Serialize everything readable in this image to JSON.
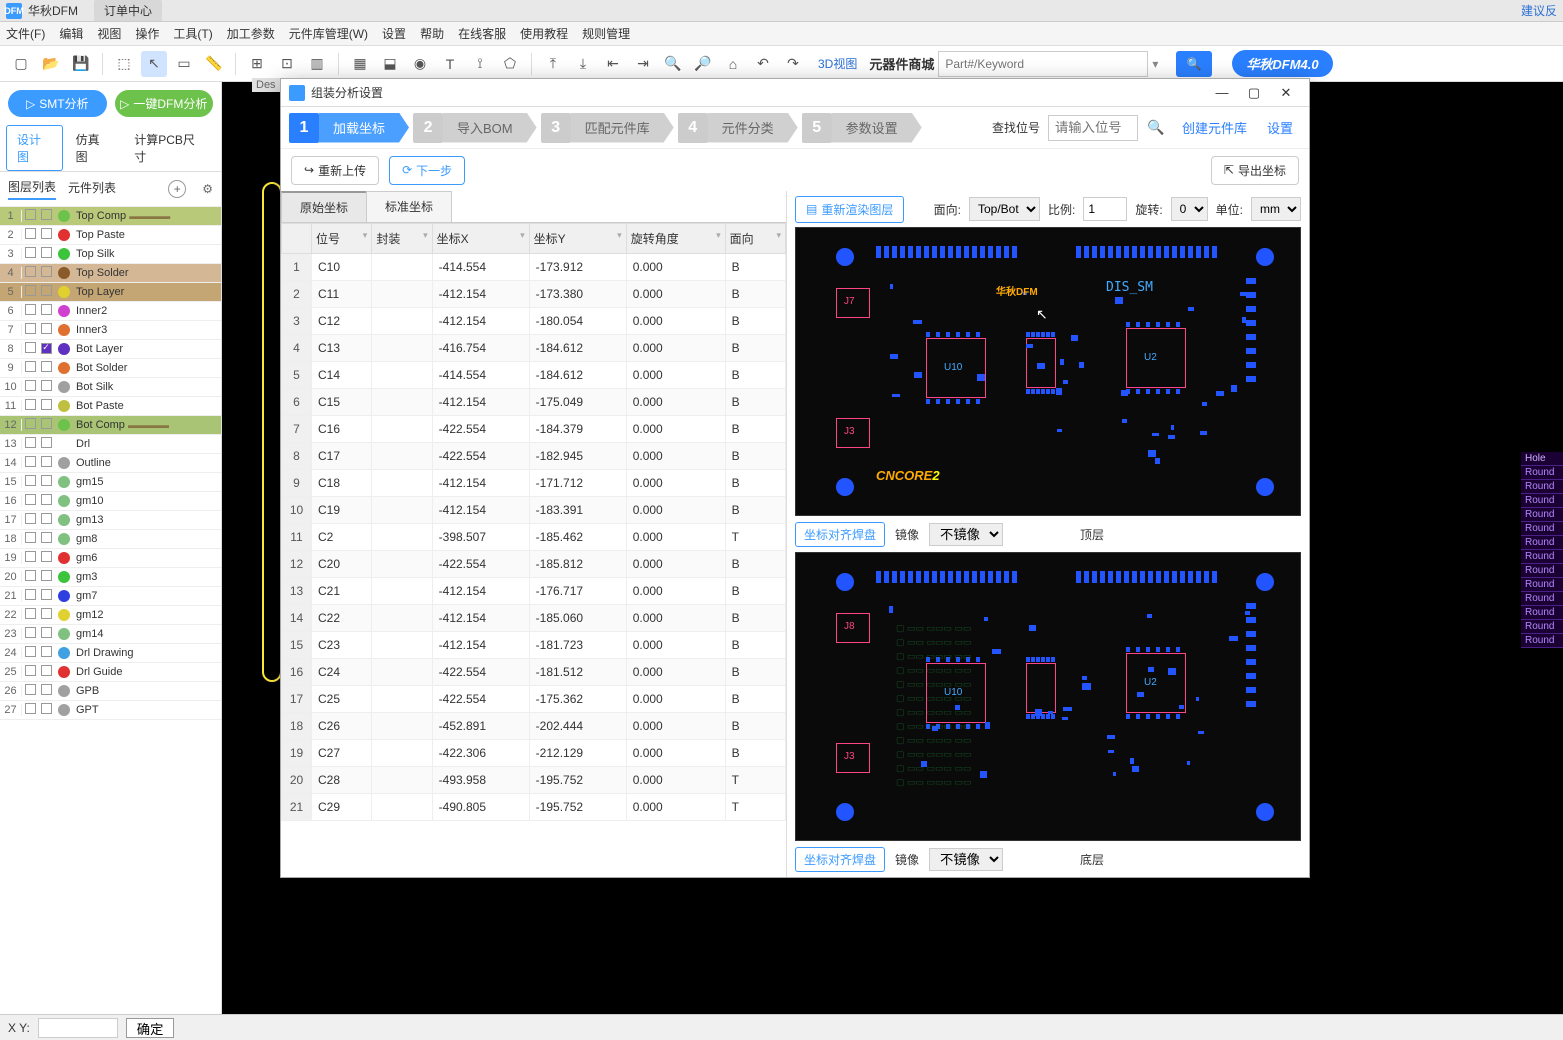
{
  "titlebar": {
    "app": "华秋DFM",
    "tab": "订单中心",
    "right_link": "建议反"
  },
  "menubar": [
    "文件(F)",
    "编辑",
    "视图",
    "操作",
    "工具(T)",
    "加工参数",
    "元件库管理(W)",
    "设置",
    "帮助",
    "在线客服",
    "使用教程",
    "规则管理"
  ],
  "toolbar": {
    "link3d": "3D视图",
    "mall": "元器件商城",
    "search_placeholder": "Part#/Keyword",
    "version": "华秋DFM4.0"
  },
  "left": {
    "btn_smt": "SMT分析",
    "btn_dfm": "一键DFM分析",
    "tabs": [
      "设计图",
      "仿真图",
      "计算PCB尺寸"
    ],
    "subtabs": [
      "图层列表",
      "元件列表"
    ],
    "layers": [
      {
        "n": 1,
        "name": "Top Comp",
        "color": "#6cc24a",
        "hl": "hl1",
        "deco": true
      },
      {
        "n": 2,
        "name": "Top Paste",
        "color": "#e03030"
      },
      {
        "n": 3,
        "name": "Top Silk",
        "color": "#3cc43c"
      },
      {
        "n": 4,
        "name": "Top Solder",
        "color": "#8a5a2a",
        "hl": "hl2"
      },
      {
        "n": 5,
        "name": "Top Layer",
        "color": "#e0d030",
        "hl": "hl3"
      },
      {
        "n": 6,
        "name": "Inner2",
        "color": "#d040d0"
      },
      {
        "n": 7,
        "name": "Inner3",
        "color": "#e07030"
      },
      {
        "n": 8,
        "name": "Bot Layer",
        "color": "#6030c0",
        "checked": true
      },
      {
        "n": 9,
        "name": "Bot Solder",
        "color": "#e07030"
      },
      {
        "n": 10,
        "name": "Bot Silk",
        "color": "#a0a0a0"
      },
      {
        "n": 11,
        "name": "Bot Paste",
        "color": "#c0c040"
      },
      {
        "n": 12,
        "name": "Bot Comp",
        "color": "#6cc24a",
        "hl": "hl4",
        "deco": true
      },
      {
        "n": 13,
        "name": "Drl",
        "color": "#ffffff"
      },
      {
        "n": 14,
        "name": "Outline",
        "color": "#a0a0a0"
      },
      {
        "n": 15,
        "name": "gm15",
        "color": "#80c080"
      },
      {
        "n": 16,
        "name": "gm10",
        "color": "#80c080"
      },
      {
        "n": 17,
        "name": "gm13",
        "color": "#80c080"
      },
      {
        "n": 18,
        "name": "gm8",
        "color": "#80c080"
      },
      {
        "n": 19,
        "name": "gm6",
        "color": "#e03030"
      },
      {
        "n": 20,
        "name": "gm3",
        "color": "#3cc43c"
      },
      {
        "n": 21,
        "name": "gm7",
        "color": "#3040e0"
      },
      {
        "n": 22,
        "name": "gm12",
        "color": "#e0d030"
      },
      {
        "n": 23,
        "name": "gm14",
        "color": "#80c080"
      },
      {
        "n": 24,
        "name": "Drl Drawing",
        "color": "#40a0e0"
      },
      {
        "n": 25,
        "name": "Drl Guide",
        "color": "#e03030"
      },
      {
        "n": 26,
        "name": "GPB",
        "color": "#a0a0a0"
      },
      {
        "n": 27,
        "name": "GPT",
        "color": "#a0a0a0"
      }
    ]
  },
  "statusbar": {
    "xy_label": "X Y:",
    "confirm": "确定"
  },
  "hole_table": {
    "header": "Hole",
    "rows": [
      "Round",
      "Round",
      "Round",
      "Round",
      "Round",
      "Round",
      "Round",
      "Round",
      "Round",
      "Round",
      "Round",
      "Round",
      "Round"
    ]
  },
  "modal": {
    "title": "组装分析设置",
    "steps": [
      {
        "n": "1",
        "label": "加载坐标",
        "active": true
      },
      {
        "n": "2",
        "label": "导入BOM"
      },
      {
        "n": "3",
        "label": "匹配元件库"
      },
      {
        "n": "4",
        "label": "元件分类"
      },
      {
        "n": "5",
        "label": "参数设置"
      }
    ],
    "find_label": "查找位号",
    "find_placeholder": "请输入位号",
    "create_lib": "创建元件库",
    "settings": "设置",
    "reupload": "重新上传",
    "next": "下一步",
    "export": "导出坐标",
    "table_tabs": [
      "原始坐标",
      "标准坐标"
    ],
    "columns": [
      "位号",
      "封装",
      "坐标X",
      "坐标Y",
      "旋转角度",
      "面向"
    ],
    "rows": [
      {
        "i": 1,
        "ref": "C10",
        "pkg": "",
        "x": "-414.554",
        "y": "-173.912",
        "r": "0.000",
        "s": "B"
      },
      {
        "i": 2,
        "ref": "C11",
        "pkg": "",
        "x": "-412.154",
        "y": "-173.380",
        "r": "0.000",
        "s": "B"
      },
      {
        "i": 3,
        "ref": "C12",
        "pkg": "",
        "x": "-412.154",
        "y": "-180.054",
        "r": "0.000",
        "s": "B"
      },
      {
        "i": 4,
        "ref": "C13",
        "pkg": "",
        "x": "-416.754",
        "y": "-184.612",
        "r": "0.000",
        "s": "B"
      },
      {
        "i": 5,
        "ref": "C14",
        "pkg": "",
        "x": "-414.554",
        "y": "-184.612",
        "r": "0.000",
        "s": "B"
      },
      {
        "i": 6,
        "ref": "C15",
        "pkg": "",
        "x": "-412.154",
        "y": "-175.049",
        "r": "0.000",
        "s": "B"
      },
      {
        "i": 7,
        "ref": "C16",
        "pkg": "",
        "x": "-422.554",
        "y": "-184.379",
        "r": "0.000",
        "s": "B"
      },
      {
        "i": 8,
        "ref": "C17",
        "pkg": "",
        "x": "-422.554",
        "y": "-182.945",
        "r": "0.000",
        "s": "B"
      },
      {
        "i": 9,
        "ref": "C18",
        "pkg": "",
        "x": "-412.154",
        "y": "-171.712",
        "r": "0.000",
        "s": "B"
      },
      {
        "i": 10,
        "ref": "C19",
        "pkg": "",
        "x": "-412.154",
        "y": "-183.391",
        "r": "0.000",
        "s": "B"
      },
      {
        "i": 11,
        "ref": "C2",
        "pkg": "",
        "x": "-398.507",
        "y": "-185.462",
        "r": "0.000",
        "s": "T"
      },
      {
        "i": 12,
        "ref": "C20",
        "pkg": "",
        "x": "-422.554",
        "y": "-185.812",
        "r": "0.000",
        "s": "B"
      },
      {
        "i": 13,
        "ref": "C21",
        "pkg": "",
        "x": "-412.154",
        "y": "-176.717",
        "r": "0.000",
        "s": "B"
      },
      {
        "i": 14,
        "ref": "C22",
        "pkg": "",
        "x": "-412.154",
        "y": "-185.060",
        "r": "0.000",
        "s": "B"
      },
      {
        "i": 15,
        "ref": "C23",
        "pkg": "",
        "x": "-412.154",
        "y": "-181.723",
        "r": "0.000",
        "s": "B"
      },
      {
        "i": 16,
        "ref": "C24",
        "pkg": "",
        "x": "-422.554",
        "y": "-181.512",
        "r": "0.000",
        "s": "B"
      },
      {
        "i": 17,
        "ref": "C25",
        "pkg": "",
        "x": "-422.554",
        "y": "-175.362",
        "r": "0.000",
        "s": "B"
      },
      {
        "i": 18,
        "ref": "C26",
        "pkg": "",
        "x": "-452.891",
        "y": "-202.444",
        "r": "0.000",
        "s": "B"
      },
      {
        "i": 19,
        "ref": "C27",
        "pkg": "",
        "x": "-422.306",
        "y": "-212.129",
        "r": "0.000",
        "s": "B"
      },
      {
        "i": 20,
        "ref": "C28",
        "pkg": "",
        "x": "-493.958",
        "y": "-195.752",
        "r": "0.000",
        "s": "T"
      },
      {
        "i": 21,
        "ref": "C29",
        "pkg": "",
        "x": "-490.805",
        "y": "-195.752",
        "r": "0.000",
        "s": "T"
      }
    ],
    "preview": {
      "rerender": "重新渲染图层",
      "orient_label": "面向:",
      "orient_value": "Top/Bot",
      "scale_label": "比例:",
      "scale_value": "1",
      "rotate_label": "旋转:",
      "rotate_value": "0",
      "unit_label": "单位:",
      "unit_value": "mm",
      "align": "坐标对齐焊盘",
      "mirror_label": "镜像",
      "mirror_value": "不镜像",
      "top_label": "顶层",
      "bot_label": "底层",
      "logo": "华秋DFM",
      "dis_sm": "DIS_SM",
      "u10": "U10",
      "u2": "U2",
      "j8": "J8",
      "j3": "J3",
      "cncore": "CNCORE",
      "cncore2": "2"
    }
  }
}
